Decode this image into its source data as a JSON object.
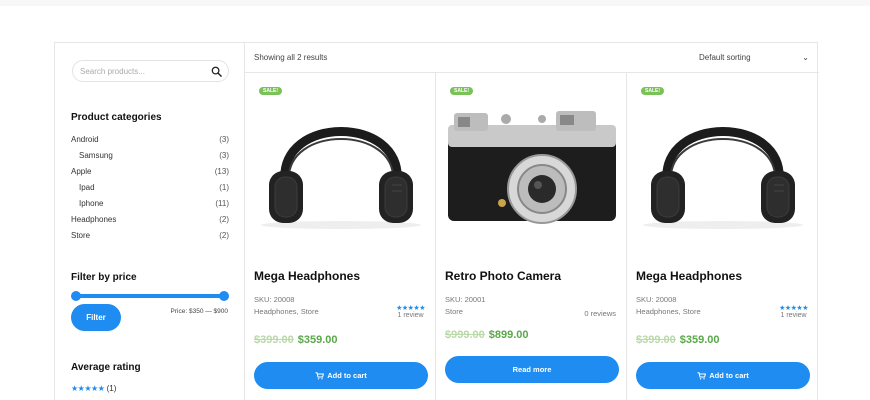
{
  "search": {
    "placeholder": "Search products..."
  },
  "categories_widget": {
    "title": "Product categories",
    "items": [
      {
        "name": "Android",
        "count": "(3)"
      },
      {
        "name": "Samsung",
        "count": "(3)"
      },
      {
        "name": "Apple",
        "count": "(13)"
      },
      {
        "name": "Ipad",
        "count": "(1)"
      },
      {
        "name": "Iphone",
        "count": "(11)"
      },
      {
        "name": "Headphones",
        "count": "(2)"
      },
      {
        "name": "Store",
        "count": "(2)"
      }
    ]
  },
  "price_filter": {
    "title": "Filter by price",
    "button_label": "Filter",
    "range_label": "Price: $350 — $900",
    "min": 350,
    "max": 900
  },
  "average_rating": {
    "title": "Average rating",
    "stars": "★★★★★",
    "count": "(1)"
  },
  "toolbar": {
    "result_count": "Showing all 2 results",
    "sort_selected": "Default sorting",
    "sort_chevron": "⌄"
  },
  "products": [
    {
      "badge": "SALE!",
      "name": "Mega Headphones",
      "sku": "SKU: 20008",
      "categories": "Headphones, Store",
      "stars": "★★★★★",
      "reviews": "1 review",
      "old_price": "$399.00",
      "price": "$359.00",
      "button_label": "Add to cart",
      "image": "headphones"
    },
    {
      "badge": "SALE!",
      "name": "Retro Photo Camera",
      "sku": "SKU: 20001",
      "categories": "Store",
      "reviews": "0 reviews",
      "old_price": "$999.00",
      "price": "$899.00",
      "button_label": "Read more",
      "image": "camera"
    },
    {
      "badge": "SALE!",
      "name": "Mega Headphones",
      "sku": "SKU: 20008",
      "categories": "Headphones, Store",
      "stars": "★★★★★",
      "reviews": "1 review",
      "old_price": "$399.00",
      "price": "$359.00",
      "button_label": "Add to cart",
      "image": "headphones"
    }
  ],
  "colors": {
    "accent": "#1e8cf0",
    "sale_badge": "#78c257",
    "price_new": "#5aa84a",
    "price_old": "#b9d9a8"
  }
}
